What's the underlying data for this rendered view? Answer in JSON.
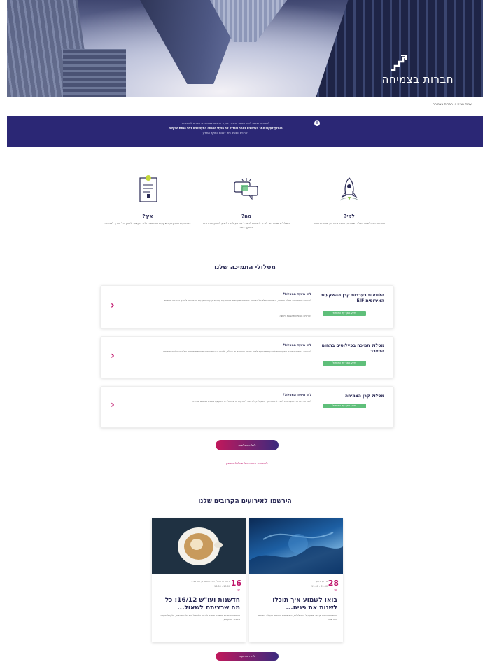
{
  "hero": {
    "title": "חברות בצמיחה"
  },
  "breadcrumb": "עמוד הבית > חברות בצמיחה",
  "notice": {
    "line1": "לתשומת לבכם: לאור המצב הנוכחי, מועדי ההגשה במסלולים עשויים להשתנות",
    "line2": "מומלץ לעקוב אחר העדכונים באתר ולבדוק את מועדי ההגשה המעודכנים לפני הגשת הבקשה",
    "line3": "לפרטים נוספים ניתן לפנות למוקד המידע"
  },
  "features": [
    {
      "icon": "rocket-icon",
      "title": "למי?",
      "text": "לחברות טכנולוגיות בשלב הצמיחה, שכבר גייסו הון ומוכרות מוצר"
    },
    {
      "icon": "chat-icon",
      "title": "מה?",
      "text": "מסלולים שמטרתם לסייע לחברות להגדיל את פעילותן ולהגיע לשווקים חדשים בהיקף רחב"
    },
    {
      "icon": "document-icon",
      "title": "איך?",
      "text": "באמצעות מענקים, השקעות משותפות וליווי מקצועי לאורך כל הדרך לצמיחה"
    }
  ],
  "tracks_title": "מסלולי התמיכה שלנו",
  "tracks": [
    {
      "name": "הלוואות בערבות קרן ההשקעות האירופית EIF",
      "pill": "מידע נוסף על המסלול",
      "sub": "למי מיועד המסלול?",
      "desc": "לחברות טכנולוגיות בשלב צמיחה, המעוניינות לקבל הלוואה בתנאים מועדפים באמצעות ערבות קרן ההשקעות האירופית לצורך הרחבת פעילותן",
      "desc2": "לפרטים נוספים ולהגשת בקשה"
    },
    {
      "name": "מסלול תמיכה בפיילוטים בתחום הסייבר",
      "pill": "מידע נוסף על המסלול",
      "sub": "למי מיועד המסלול?",
      "desc": "לחברות בתחום הסייבר המעוניינות לבצע פיילוט עם לקוח ראשון בישראל או בחו\"ל, לצורך הוכחת היתכנות ויכולת מסחור של הטכנולוגיה שפיתחו"
    },
    {
      "name": "מסלול קרן הצמיחה",
      "pill": "מידע נוסף על המסלול",
      "sub": "למי מיועד המסלול?",
      "desc": "לחברות בוגרות המעוניינות להגדיל את היקף הפעילות, להיכנס לשווקים חדשים ולגייס השקעה נוספת מגופים פרטיים"
    }
  ],
  "tracks_button": "לכל המסלולים",
  "tracks_link": "להשוואה מהירה של מסלולי המימון",
  "events_title": "הירשמו לאירועים הקרובים שלנו",
  "events": [
    {
      "day": "28",
      "month": "יוני",
      "meta1": "אירוע מקוון",
      "meta2": "09:30 - 11:00",
      "title": "בואו לשמוע איך תוכלו לשנות את פניה...",
      "desc": "השתתפו בכנס וקבלו מידע על המסלולים, הזדמנויות ושיתופי פעולה בתחום החדשנות"
    },
    {
      "day": "16",
      "month": "יוני",
      "meta1": "אירוע פרונטלי, מרכז הכנסים, תל אביב",
      "meta2": "10:00 - 13:00",
      "title": "חדשנות ועו\"ש 16/12: כל מה שרציתם לשאול...",
      "desc": "רשות החדשנות מזמינה אתכם להגיע ולשאול את כל השאלות, ולקבל מענה מאנשי המקצוע"
    }
  ],
  "events_button": "לכל האירועים"
}
